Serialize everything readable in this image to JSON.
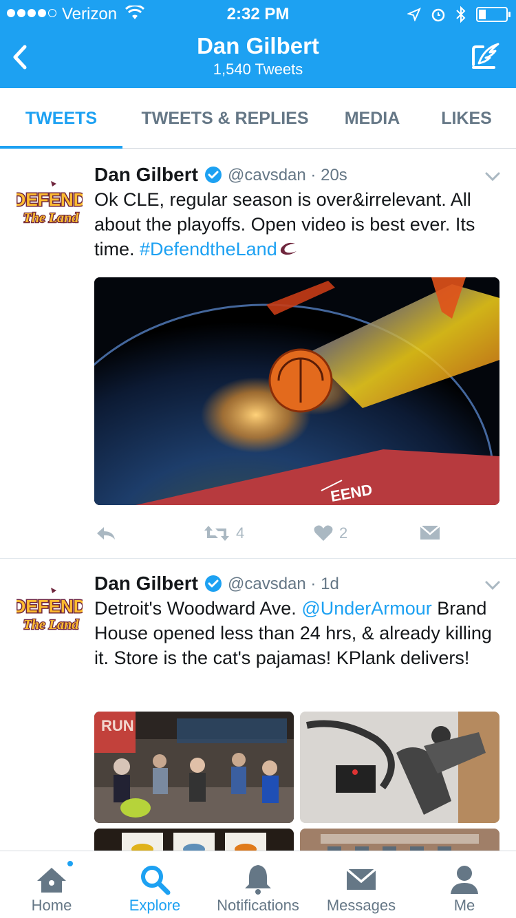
{
  "status_bar": {
    "carrier": "Verizon",
    "time": "2:32 PM"
  },
  "nav": {
    "title": "Dan Gilbert",
    "subtitle": "1,540 Tweets"
  },
  "tabs": [
    {
      "label": "TWEETS",
      "active": true
    },
    {
      "label": "TWEETS & REPLIES",
      "active": false
    },
    {
      "label": "MEDIA",
      "active": false
    },
    {
      "label": "LIKES",
      "active": false
    }
  ],
  "tweets": [
    {
      "name": "Dan Gilbert",
      "handle": "@cavsdan",
      "time": "20s",
      "text_plain": "Ok CLE, regular season is over&irrelevant. All about the playoffs. Open video is best ever. Its time.",
      "hashtag": "#DefendtheLand",
      "media_caption_fragment": "EEND",
      "retweets": "4",
      "likes": "2"
    },
    {
      "name": "Dan Gilbert",
      "handle": "@cavsdan",
      "time": "1d",
      "text_before": "Detroit's Woodward Ave.",
      "mention": "@UnderArmour",
      "text_after": "Brand House opened less than 24 hrs, & already killing it. Store is the cat's pajamas! KPlank delivers!",
      "media_sign": "RUN"
    }
  ],
  "avatar_logo": {
    "line1": "DEFEND",
    "line2": "The Land"
  },
  "bottom_nav": [
    {
      "label": "Home",
      "icon": "home-icon",
      "active": false
    },
    {
      "label": "Explore",
      "icon": "search-icon",
      "active": true
    },
    {
      "label": "Notifications",
      "icon": "bell-icon",
      "active": false
    },
    {
      "label": "Messages",
      "icon": "envelope-icon",
      "active": false
    },
    {
      "label": "Me",
      "icon": "person-icon",
      "active": false
    }
  ],
  "colors": {
    "brand": "#1da1f2",
    "text": "#14171a",
    "muted": "#657786",
    "cavs_wine": "#6f263d",
    "cavs_gold": "#fdbb30"
  }
}
